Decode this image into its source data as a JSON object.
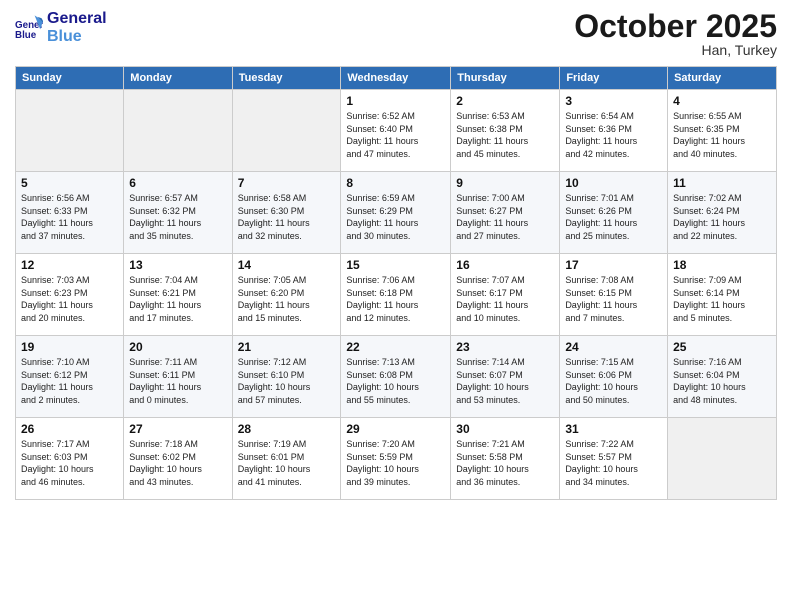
{
  "logo": {
    "line1": "General",
    "line2": "Blue"
  },
  "header": {
    "month": "October 2025",
    "location": "Han, Turkey"
  },
  "weekdays": [
    "Sunday",
    "Monday",
    "Tuesday",
    "Wednesday",
    "Thursday",
    "Friday",
    "Saturday"
  ],
  "weeks": [
    [
      {
        "day": "",
        "info": ""
      },
      {
        "day": "",
        "info": ""
      },
      {
        "day": "",
        "info": ""
      },
      {
        "day": "1",
        "info": "Sunrise: 6:52 AM\nSunset: 6:40 PM\nDaylight: 11 hours\nand 47 minutes."
      },
      {
        "day": "2",
        "info": "Sunrise: 6:53 AM\nSunset: 6:38 PM\nDaylight: 11 hours\nand 45 minutes."
      },
      {
        "day": "3",
        "info": "Sunrise: 6:54 AM\nSunset: 6:36 PM\nDaylight: 11 hours\nand 42 minutes."
      },
      {
        "day": "4",
        "info": "Sunrise: 6:55 AM\nSunset: 6:35 PM\nDaylight: 11 hours\nand 40 minutes."
      }
    ],
    [
      {
        "day": "5",
        "info": "Sunrise: 6:56 AM\nSunset: 6:33 PM\nDaylight: 11 hours\nand 37 minutes."
      },
      {
        "day": "6",
        "info": "Sunrise: 6:57 AM\nSunset: 6:32 PM\nDaylight: 11 hours\nand 35 minutes."
      },
      {
        "day": "7",
        "info": "Sunrise: 6:58 AM\nSunset: 6:30 PM\nDaylight: 11 hours\nand 32 minutes."
      },
      {
        "day": "8",
        "info": "Sunrise: 6:59 AM\nSunset: 6:29 PM\nDaylight: 11 hours\nand 30 minutes."
      },
      {
        "day": "9",
        "info": "Sunrise: 7:00 AM\nSunset: 6:27 PM\nDaylight: 11 hours\nand 27 minutes."
      },
      {
        "day": "10",
        "info": "Sunrise: 7:01 AM\nSunset: 6:26 PM\nDaylight: 11 hours\nand 25 minutes."
      },
      {
        "day": "11",
        "info": "Sunrise: 7:02 AM\nSunset: 6:24 PM\nDaylight: 11 hours\nand 22 minutes."
      }
    ],
    [
      {
        "day": "12",
        "info": "Sunrise: 7:03 AM\nSunset: 6:23 PM\nDaylight: 11 hours\nand 20 minutes."
      },
      {
        "day": "13",
        "info": "Sunrise: 7:04 AM\nSunset: 6:21 PM\nDaylight: 11 hours\nand 17 minutes."
      },
      {
        "day": "14",
        "info": "Sunrise: 7:05 AM\nSunset: 6:20 PM\nDaylight: 11 hours\nand 15 minutes."
      },
      {
        "day": "15",
        "info": "Sunrise: 7:06 AM\nSunset: 6:18 PM\nDaylight: 11 hours\nand 12 minutes."
      },
      {
        "day": "16",
        "info": "Sunrise: 7:07 AM\nSunset: 6:17 PM\nDaylight: 11 hours\nand 10 minutes."
      },
      {
        "day": "17",
        "info": "Sunrise: 7:08 AM\nSunset: 6:15 PM\nDaylight: 11 hours\nand 7 minutes."
      },
      {
        "day": "18",
        "info": "Sunrise: 7:09 AM\nSunset: 6:14 PM\nDaylight: 11 hours\nand 5 minutes."
      }
    ],
    [
      {
        "day": "19",
        "info": "Sunrise: 7:10 AM\nSunset: 6:12 PM\nDaylight: 11 hours\nand 2 minutes."
      },
      {
        "day": "20",
        "info": "Sunrise: 7:11 AM\nSunset: 6:11 PM\nDaylight: 11 hours\nand 0 minutes."
      },
      {
        "day": "21",
        "info": "Sunrise: 7:12 AM\nSunset: 6:10 PM\nDaylight: 10 hours\nand 57 minutes."
      },
      {
        "day": "22",
        "info": "Sunrise: 7:13 AM\nSunset: 6:08 PM\nDaylight: 10 hours\nand 55 minutes."
      },
      {
        "day": "23",
        "info": "Sunrise: 7:14 AM\nSunset: 6:07 PM\nDaylight: 10 hours\nand 53 minutes."
      },
      {
        "day": "24",
        "info": "Sunrise: 7:15 AM\nSunset: 6:06 PM\nDaylight: 10 hours\nand 50 minutes."
      },
      {
        "day": "25",
        "info": "Sunrise: 7:16 AM\nSunset: 6:04 PM\nDaylight: 10 hours\nand 48 minutes."
      }
    ],
    [
      {
        "day": "26",
        "info": "Sunrise: 7:17 AM\nSunset: 6:03 PM\nDaylight: 10 hours\nand 46 minutes."
      },
      {
        "day": "27",
        "info": "Sunrise: 7:18 AM\nSunset: 6:02 PM\nDaylight: 10 hours\nand 43 minutes."
      },
      {
        "day": "28",
        "info": "Sunrise: 7:19 AM\nSunset: 6:01 PM\nDaylight: 10 hours\nand 41 minutes."
      },
      {
        "day": "29",
        "info": "Sunrise: 7:20 AM\nSunset: 5:59 PM\nDaylight: 10 hours\nand 39 minutes."
      },
      {
        "day": "30",
        "info": "Sunrise: 7:21 AM\nSunset: 5:58 PM\nDaylight: 10 hours\nand 36 minutes."
      },
      {
        "day": "31",
        "info": "Sunrise: 7:22 AM\nSunset: 5:57 PM\nDaylight: 10 hours\nand 34 minutes."
      },
      {
        "day": "",
        "info": ""
      }
    ]
  ]
}
